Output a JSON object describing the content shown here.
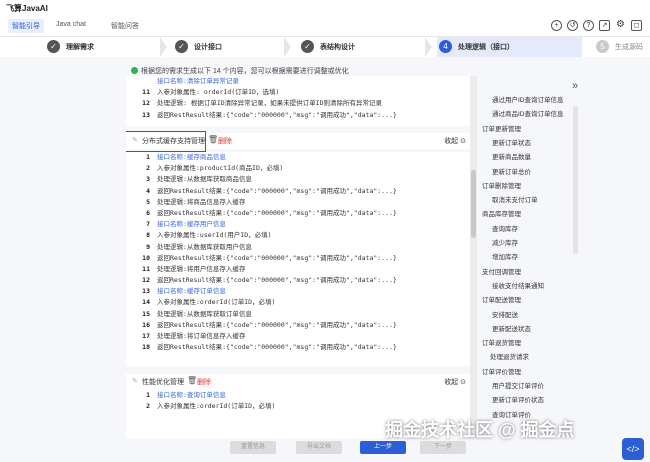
{
  "app": {
    "title": "飞算JavaAI"
  },
  "tabs": [
    {
      "label": "智能引导"
    },
    {
      "label": "Java chat"
    },
    {
      "label": "智能问答"
    }
  ],
  "top_icons": [
    "plus-circle-icon",
    "history-icon",
    "help-icon",
    "export-icon",
    "settings-icon",
    "restore-icon"
  ],
  "steps": [
    {
      "num": "✓",
      "label": "理解需求"
    },
    {
      "num": "✓",
      "label": "设计接口"
    },
    {
      "num": "✓",
      "label": "表结构设计"
    },
    {
      "num": "4",
      "label": "处理逻辑（接口）"
    },
    {
      "num": "5",
      "label": "生成源码"
    }
  ],
  "notice": "根据您的需求生成以下 14 个内容，您可以根据需要进行调整或优化",
  "section0": {
    "lines": [
      {
        "n": "",
        "t": "接口名称:清除订单异常记录",
        "link": true
      },
      {
        "n": "11",
        "t": "入参对象属性: orderId(订单ID，选填)"
      },
      {
        "n": "12",
        "t": "处理逻辑: 根据订单ID清除异常记录，如果未提供订单ID则清除所有异常记录"
      },
      {
        "n": "13",
        "t": "返回RestResult结果:{\"code\":\"000000\",\"msg\":\"调用成功\",\"data\":...}"
      }
    ]
  },
  "section1": {
    "title": "分布式缓存支持管理",
    "delete": "删除",
    "fold": "收起",
    "lines": [
      {
        "n": "1",
        "t": "接口名称:缓存商品信息",
        "link": true
      },
      {
        "n": "2",
        "t": "入参对象属性:productId(商品ID，必填)"
      },
      {
        "n": "3",
        "t": "处理逻辑:从数据库获取商品信息"
      },
      {
        "n": "4",
        "t": "返回RestResult结果:{\"code\":\"000000\",\"msg\":\"调用成功\",\"data\":...}"
      },
      {
        "n": "5",
        "t": "处理逻辑:将商品信息存入缓存"
      },
      {
        "n": "6",
        "t": "返回RestResult结果:{\"code\":\"000000\",\"msg\":\"调用成功\",\"data\":...}"
      },
      {
        "n": "7",
        "t": "接口名称:缓存用户信息",
        "link": true
      },
      {
        "n": "8",
        "t": "入参对象属性:userId(用户ID，必填)"
      },
      {
        "n": "9",
        "t": "处理逻辑:从数据库获取用户信息"
      },
      {
        "n": "10",
        "t": "返回RestResult结果:{\"code\":\"000000\",\"msg\":\"调用成功\",\"data\":...}"
      },
      {
        "n": "11",
        "t": "处理逻辑:将用户信息存入缓存"
      },
      {
        "n": "12",
        "t": "返回RestResult结果:{\"code\":\"000000\",\"msg\":\"调用成功\",\"data\":...}"
      },
      {
        "n": "13",
        "t": "接口名称:缓存订单信息",
        "link": true
      },
      {
        "n": "14",
        "t": "入参对象属性:orderId(订单ID，必填)"
      },
      {
        "n": "15",
        "t": "处理逻辑:从数据库获取订单信息"
      },
      {
        "n": "16",
        "t": "返回RestResult结果:{\"code\":\"000000\",\"msg\":\"调用成功\",\"data\":...}"
      },
      {
        "n": "17",
        "t": "处理逻辑:将订单信息存入缓存"
      },
      {
        "n": "18",
        "t": "返回RestResult结果:{\"code\":\"000000\",\"msg\":\"调用成功\",\"data\":...}"
      }
    ]
  },
  "section2": {
    "title": "性能优化管理",
    "delete": "删除",
    "fold": "收起",
    "lines": [
      {
        "n": "1",
        "t": "接口名称:查询订单信息",
        "link": true
      },
      {
        "n": "2",
        "t": "入参对象属性:orderId(订单ID，必填)"
      }
    ]
  },
  "tree": [
    {
      "t": "通过用户ID查询订单信息",
      "lvl": 1
    },
    {
      "t": "通过商品ID查询订单信息",
      "lvl": 1
    },
    {
      "t": "订单更新管理",
      "lvl": 0
    },
    {
      "t": "更新订单状态",
      "lvl": 1
    },
    {
      "t": "更新商品数量",
      "lvl": 1
    },
    {
      "t": "更新订单总价",
      "lvl": 1
    },
    {
      "t": "订单删除管理",
      "lvl": 0
    },
    {
      "t": "取消未支付订单",
      "lvl": 1
    },
    {
      "t": "商品库存管理",
      "lvl": 0
    },
    {
      "t": "查询库存",
      "lvl": 1
    },
    {
      "t": "减少库存",
      "lvl": 1
    },
    {
      "t": "增加库存",
      "lvl": 1
    },
    {
      "t": "支付回调管理",
      "lvl": 0
    },
    {
      "t": "接收支付结果通知",
      "lvl": 1
    },
    {
      "t": "订单配送管理",
      "lvl": 0
    },
    {
      "t": "安排配送",
      "lvl": 1
    },
    {
      "t": "更新配送状态",
      "lvl": 1
    },
    {
      "t": "订单退货管理",
      "lvl": 0
    },
    {
      "t": "处理退货请求",
      "lvl": 2
    },
    {
      "t": "订单评价管理",
      "lvl": 0
    },
    {
      "t": "用户提交订单评价",
      "lvl": 1
    },
    {
      "t": "更新订单评价状态",
      "lvl": 1
    },
    {
      "t": "查询订单评价",
      "lvl": 1
    }
  ],
  "footer": {
    "btn1": "重置信息",
    "btn2": "导出文档",
    "prev": "上一步",
    "next": "下一步"
  },
  "watermark": "掘金技术社区 @ 掘金点",
  "colors": {
    "accent": "#2c5fd6",
    "highlight_box": "#e02020",
    "link": "#3366dd",
    "success": "#29b24e"
  }
}
